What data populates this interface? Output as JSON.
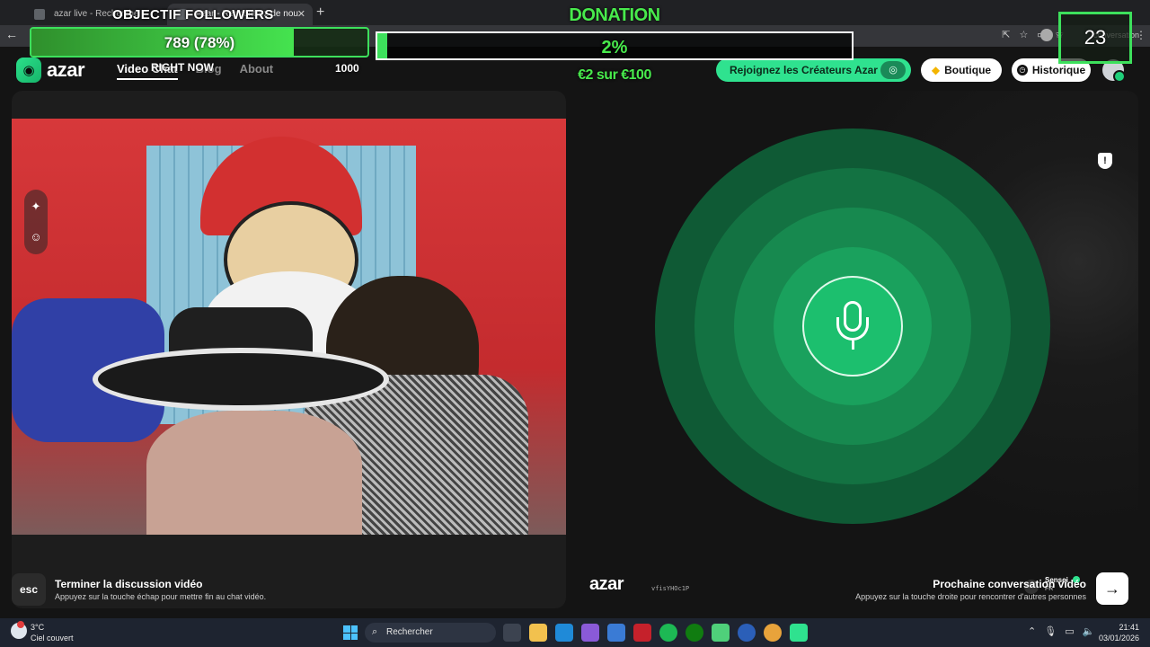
{
  "browser": {
    "tabs": [
      {
        "title": "azar live - Recherche",
        "active": false
      },
      {
        "title": "Azar - Rencontrez de nou",
        "active": true
      }
    ],
    "new_tab_icon": "plus-icon",
    "address_right_text": "conversation"
  },
  "app": {
    "logo_text": "azar",
    "nav": [
      {
        "label": "Video Chat",
        "active": true
      },
      {
        "label": "Blog",
        "active": false
      },
      {
        "label": "About",
        "active": false
      }
    ],
    "creators_button": "Rejoignez les Créateurs Azar",
    "boutique_button": "Boutique",
    "historique_button": "Historique",
    "accent_color": "#2fe28f"
  },
  "right_panel": {
    "watermark": "azar",
    "watermark_id": "vfisYHOc1P",
    "peer_name": "Sensei",
    "peer_country": "FR"
  },
  "footer": {
    "esc_key": "esc",
    "end_title": "Terminer la discussion vidéo",
    "end_sub": "Appuyez sur la touche échap pour mettre fin au chat vidéo.",
    "next_title": "Prochaine conversation vidéo",
    "next_sub": "Appuyez sur la touche droite pour rencontrer d'autres personnes",
    "next_icon": "arrow-right-icon"
  },
  "overlay": {
    "followers_title": "OBJECTIF FOLLOWERS",
    "followers_value": "789 (78%)",
    "followers_progress": 0.78,
    "right_now_label": "RIGHT NOW",
    "target_value": "1000",
    "donation_title": "DONATION",
    "donation_percent": "2%",
    "donation_progress": 0.02,
    "donation_sub": "€2 sur €100",
    "counter": "23",
    "accent": "#3de05c"
  },
  "taskbar": {
    "temperature": "3°C",
    "condition": "Ciel couvert",
    "search_placeholder": "Rechercher",
    "time": "21:41",
    "date": "03/01/2026"
  }
}
